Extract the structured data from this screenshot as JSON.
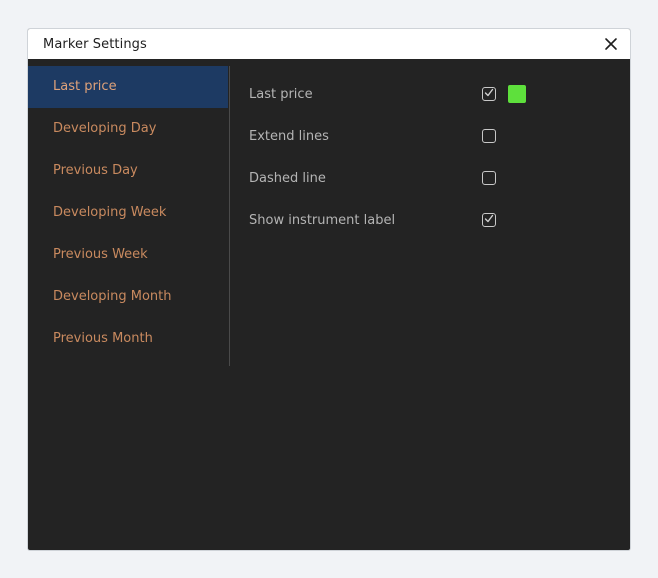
{
  "window": {
    "title": "Marker Settings",
    "close_icon": "close-icon"
  },
  "sidebar": {
    "items": [
      {
        "label": "Last price",
        "active": true
      },
      {
        "label": "Developing Day",
        "active": false
      },
      {
        "label": "Previous Day",
        "active": false
      },
      {
        "label": "Developing Week",
        "active": false
      },
      {
        "label": "Previous Week",
        "active": false
      },
      {
        "label": "Developing Month",
        "active": false
      },
      {
        "label": "Previous Month",
        "active": false
      }
    ]
  },
  "settings": {
    "rows": [
      {
        "label": "Last price",
        "checked": true,
        "color": "#5ee03c"
      },
      {
        "label": "Extend lines",
        "checked": false
      },
      {
        "label": "Dashed line",
        "checked": false
      },
      {
        "label": "Show instrument label",
        "checked": true
      }
    ]
  },
  "colors": {
    "accent_active": "#1d3a63",
    "nav_text": "#c98a5f",
    "swatch": "#5ee03c"
  }
}
